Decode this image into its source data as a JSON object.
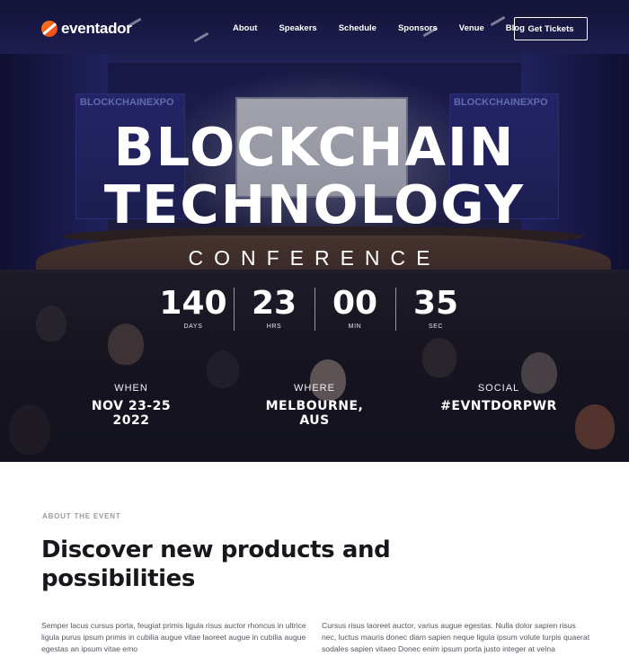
{
  "brand": {
    "name": "eventador"
  },
  "nav": {
    "links": [
      "About",
      "Speakers",
      "Schedule",
      "Sponsors",
      "Venue",
      "Blog"
    ],
    "cta": "Get Tickets"
  },
  "hero": {
    "title_line1": "BLOCKCHAIN",
    "title_line2": "TECHNOLOGY",
    "subtitle": "CONFERENCE",
    "background_banner_text": "BLOCKCHAINEXPO",
    "countdown": [
      {
        "value": "140",
        "label": "DAYS"
      },
      {
        "value": "23",
        "label": "HRS"
      },
      {
        "value": "00",
        "label": "MIN"
      },
      {
        "value": "35",
        "label": "SEC"
      }
    ],
    "info": {
      "when": {
        "label": "WHEN",
        "value": "NOV 23-25 2022"
      },
      "where": {
        "label": "WHERE",
        "value": "MELBOURNE, AUS"
      },
      "social": {
        "label": "SOCIAL",
        "value": "#EVNTDORPWR"
      }
    }
  },
  "about": {
    "eyebrow": "ABOUT THE EVENT",
    "heading": "Discover new products and possibilities",
    "para_left": "Semper lacus cursus porta, feugiat primis ligula risus auctor rhoncus in ultrice ligula purus ipsum primis in cubilia augue vitae laoreet augue in cubilia augue egestas an ipsum vitae emo",
    "para_right": "Cursus risus laoreet auctor, varius augue egestas. Nulla dolor sapien risus nec, luctus mauris donec diam sapien neque ligula ipsum volute turpis quaerat sodales sapien vitaeo Donec enim ipsum porta justo integer at velna"
  },
  "colors": {
    "brand_orange": "#ff7a1a",
    "hero_overlay": "#1c1a47",
    "heading_text": "#17171c",
    "body_text": "#555560"
  }
}
